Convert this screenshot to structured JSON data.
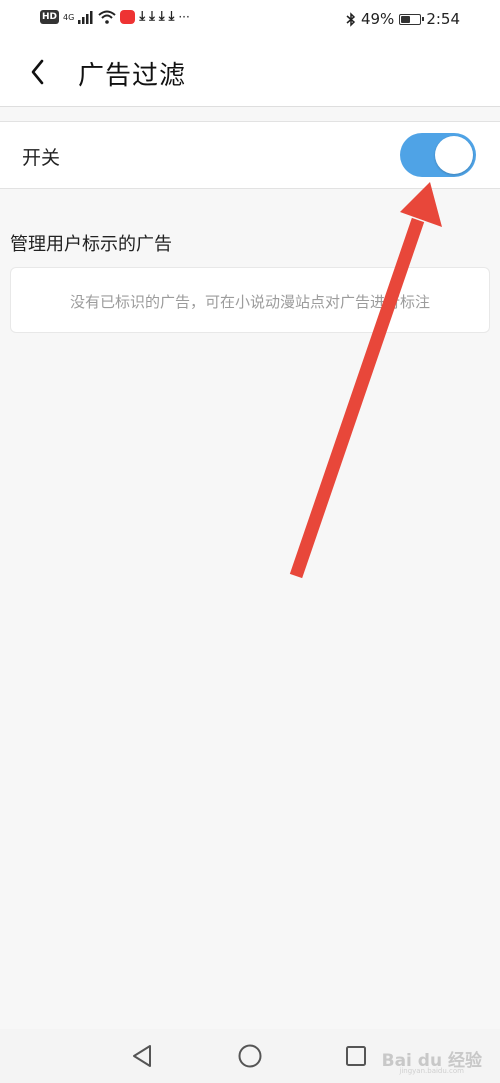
{
  "status_bar": {
    "hd": "HD",
    "network": "4G",
    "battery_percent": "49%",
    "battery_level": 0.49,
    "time": "2:54",
    "more": "···"
  },
  "header": {
    "back_icon": "chevron-left-icon",
    "title": "广告过滤"
  },
  "switch": {
    "label": "开关",
    "state": "on",
    "color": "#4fa3e6"
  },
  "section": {
    "title": "管理用户标示的广告",
    "empty_message": "没有已标识的广告，可在小说动漫站点对广告进行标注"
  },
  "annotation": {
    "arrow_color": "#e8473a"
  },
  "nav_bar": {
    "back_icon": "triangle-back-icon",
    "home_icon": "circle-home-icon",
    "recents_icon": "square-recents-icon"
  },
  "watermark": {
    "text": "Bai du 经验",
    "sub": "jingyan.baidu.com"
  }
}
